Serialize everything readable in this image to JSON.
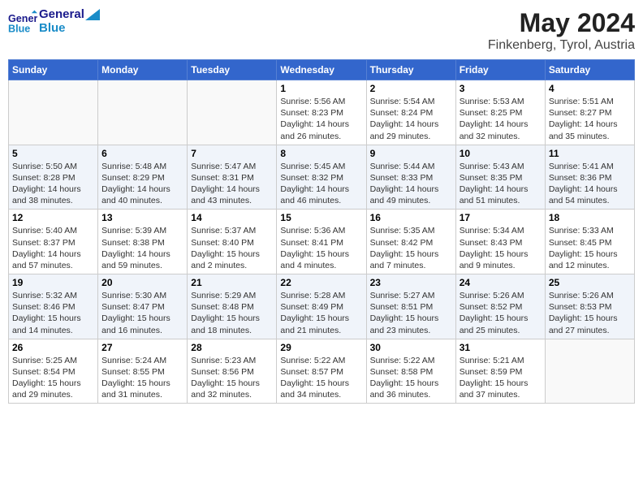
{
  "header": {
    "logo_general": "General",
    "logo_blue": "Blue",
    "month_title": "May 2024",
    "location": "Finkenberg, Tyrol, Austria"
  },
  "days_of_week": [
    "Sunday",
    "Monday",
    "Tuesday",
    "Wednesday",
    "Thursday",
    "Friday",
    "Saturday"
  ],
  "weeks": [
    [
      {
        "day": "",
        "info": ""
      },
      {
        "day": "",
        "info": ""
      },
      {
        "day": "",
        "info": ""
      },
      {
        "day": "1",
        "info": "Sunrise: 5:56 AM\nSunset: 8:23 PM\nDaylight: 14 hours and 26 minutes."
      },
      {
        "day": "2",
        "info": "Sunrise: 5:54 AM\nSunset: 8:24 PM\nDaylight: 14 hours and 29 minutes."
      },
      {
        "day": "3",
        "info": "Sunrise: 5:53 AM\nSunset: 8:25 PM\nDaylight: 14 hours and 32 minutes."
      },
      {
        "day": "4",
        "info": "Sunrise: 5:51 AM\nSunset: 8:27 PM\nDaylight: 14 hours and 35 minutes."
      }
    ],
    [
      {
        "day": "5",
        "info": "Sunrise: 5:50 AM\nSunset: 8:28 PM\nDaylight: 14 hours and 38 minutes."
      },
      {
        "day": "6",
        "info": "Sunrise: 5:48 AM\nSunset: 8:29 PM\nDaylight: 14 hours and 40 minutes."
      },
      {
        "day": "7",
        "info": "Sunrise: 5:47 AM\nSunset: 8:31 PM\nDaylight: 14 hours and 43 minutes."
      },
      {
        "day": "8",
        "info": "Sunrise: 5:45 AM\nSunset: 8:32 PM\nDaylight: 14 hours and 46 minutes."
      },
      {
        "day": "9",
        "info": "Sunrise: 5:44 AM\nSunset: 8:33 PM\nDaylight: 14 hours and 49 minutes."
      },
      {
        "day": "10",
        "info": "Sunrise: 5:43 AM\nSunset: 8:35 PM\nDaylight: 14 hours and 51 minutes."
      },
      {
        "day": "11",
        "info": "Sunrise: 5:41 AM\nSunset: 8:36 PM\nDaylight: 14 hours and 54 minutes."
      }
    ],
    [
      {
        "day": "12",
        "info": "Sunrise: 5:40 AM\nSunset: 8:37 PM\nDaylight: 14 hours and 57 minutes."
      },
      {
        "day": "13",
        "info": "Sunrise: 5:39 AM\nSunset: 8:38 PM\nDaylight: 14 hours and 59 minutes."
      },
      {
        "day": "14",
        "info": "Sunrise: 5:37 AM\nSunset: 8:40 PM\nDaylight: 15 hours and 2 minutes."
      },
      {
        "day": "15",
        "info": "Sunrise: 5:36 AM\nSunset: 8:41 PM\nDaylight: 15 hours and 4 minutes."
      },
      {
        "day": "16",
        "info": "Sunrise: 5:35 AM\nSunset: 8:42 PM\nDaylight: 15 hours and 7 minutes."
      },
      {
        "day": "17",
        "info": "Sunrise: 5:34 AM\nSunset: 8:43 PM\nDaylight: 15 hours and 9 minutes."
      },
      {
        "day": "18",
        "info": "Sunrise: 5:33 AM\nSunset: 8:45 PM\nDaylight: 15 hours and 12 minutes."
      }
    ],
    [
      {
        "day": "19",
        "info": "Sunrise: 5:32 AM\nSunset: 8:46 PM\nDaylight: 15 hours and 14 minutes."
      },
      {
        "day": "20",
        "info": "Sunrise: 5:30 AM\nSunset: 8:47 PM\nDaylight: 15 hours and 16 minutes."
      },
      {
        "day": "21",
        "info": "Sunrise: 5:29 AM\nSunset: 8:48 PM\nDaylight: 15 hours and 18 minutes."
      },
      {
        "day": "22",
        "info": "Sunrise: 5:28 AM\nSunset: 8:49 PM\nDaylight: 15 hours and 21 minutes."
      },
      {
        "day": "23",
        "info": "Sunrise: 5:27 AM\nSunset: 8:51 PM\nDaylight: 15 hours and 23 minutes."
      },
      {
        "day": "24",
        "info": "Sunrise: 5:26 AM\nSunset: 8:52 PM\nDaylight: 15 hours and 25 minutes."
      },
      {
        "day": "25",
        "info": "Sunrise: 5:26 AM\nSunset: 8:53 PM\nDaylight: 15 hours and 27 minutes."
      }
    ],
    [
      {
        "day": "26",
        "info": "Sunrise: 5:25 AM\nSunset: 8:54 PM\nDaylight: 15 hours and 29 minutes."
      },
      {
        "day": "27",
        "info": "Sunrise: 5:24 AM\nSunset: 8:55 PM\nDaylight: 15 hours and 31 minutes."
      },
      {
        "day": "28",
        "info": "Sunrise: 5:23 AM\nSunset: 8:56 PM\nDaylight: 15 hours and 32 minutes."
      },
      {
        "day": "29",
        "info": "Sunrise: 5:22 AM\nSunset: 8:57 PM\nDaylight: 15 hours and 34 minutes."
      },
      {
        "day": "30",
        "info": "Sunrise: 5:22 AM\nSunset: 8:58 PM\nDaylight: 15 hours and 36 minutes."
      },
      {
        "day": "31",
        "info": "Sunrise: 5:21 AM\nSunset: 8:59 PM\nDaylight: 15 hours and 37 minutes."
      },
      {
        "day": "",
        "info": ""
      }
    ]
  ]
}
